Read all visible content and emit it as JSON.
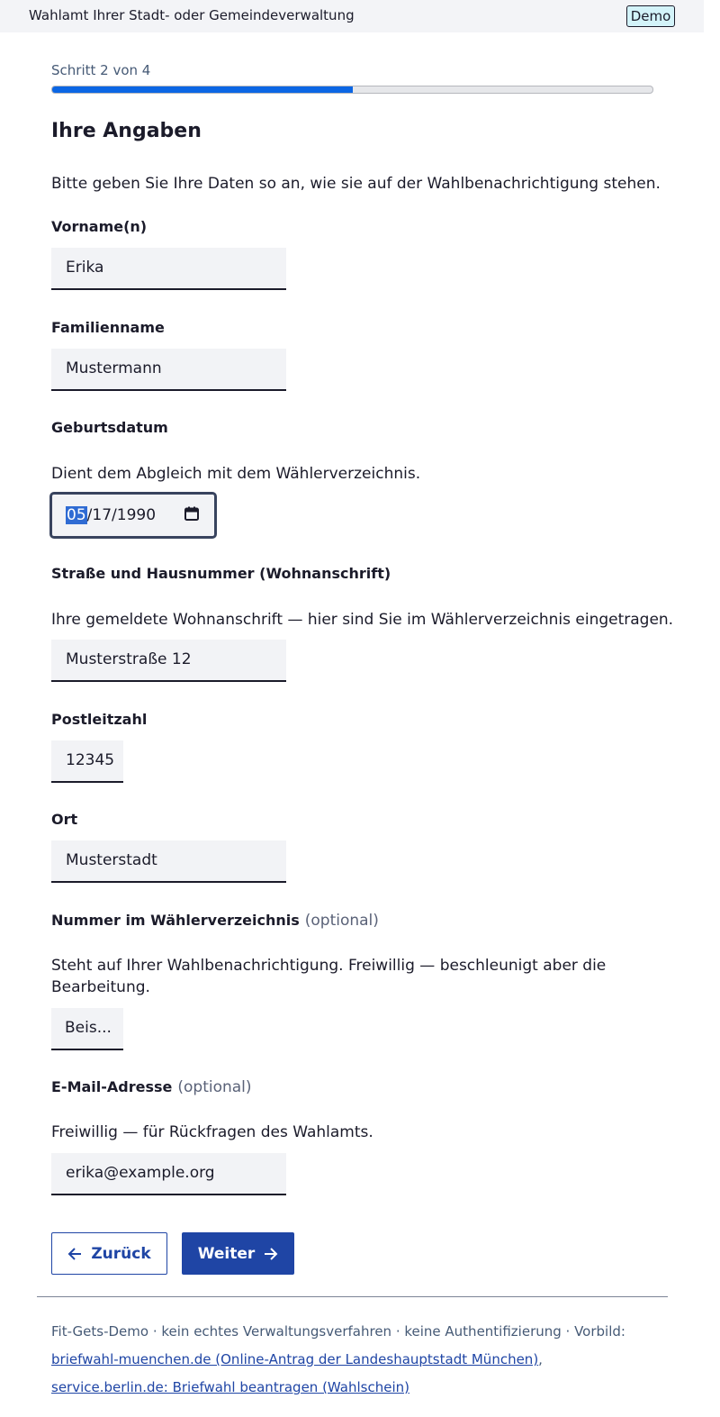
{
  "header": {
    "agency": "Wahlamt Ihrer Stadt- oder Gemeindeverwaltung",
    "badge": "Demo"
  },
  "progress": {
    "label": "Schritt 2 von 4",
    "fraction": 0.5
  },
  "form": {
    "title": "Ihre Angaben",
    "intro": "Bitte geben Sie Ihre Daten so an, wie sie auf der Wahlbenachrichtigung stehen.",
    "first_name": {
      "label": "Vorname(n)",
      "value": "Erika"
    },
    "last_name": {
      "label": "Familienname",
      "value": "Mustermann"
    },
    "birthdate": {
      "label": "Geburtsdatum",
      "hint": "Dient dem Abgleich mit dem Wählerverzeichnis.",
      "month": "05",
      "day": "17",
      "year": "1990",
      "sep": "/"
    },
    "street": {
      "label": "Straße und Hausnummer (Wohnanschrift)",
      "hint": "Ihre gemeldete Wohnanschrift — hier sind Sie im Wählerverzeichnis eingetragen.",
      "value": "Musterstraße 12"
    },
    "zip": {
      "label": "Postleitzahl",
      "value": "12345"
    },
    "city": {
      "label": "Ort",
      "value": "Musterstadt"
    },
    "register_number": {
      "label": "Nummer im Wählerverzeichnis",
      "optional": "(optional)",
      "hint": "Steht auf Ihrer Wahlbenachrichtigung. Freiwillig — beschleunigt aber die Bearbeitung.",
      "placeholder": "Beis..."
    },
    "email": {
      "label": "E-Mail-Adresse",
      "optional": "(optional)",
      "hint": "Freiwillig — für Rückfragen des Wahlamts.",
      "value": "erika@example.org"
    }
  },
  "buttons": {
    "back": "Zurück",
    "next": "Weiter"
  },
  "footer": {
    "text": "Fit-Gets-Demo · kein echtes Verwaltungsverfahren · keine Authentifizierung · Vorbild:",
    "link1": "briefwahl-muenchen.de (Online-Antrag der Landeshauptstadt München)",
    "sep": ",",
    "link2": "service.berlin.de: Briefwahl beantragen (Wahlschein)"
  },
  "colors": {
    "accent": "#1f45a5",
    "progress": "#0b66e4",
    "badge_bg": "#d3f3f9"
  },
  "icons": {
    "back": "arrow-left-icon",
    "next": "arrow-right-icon",
    "date": "calendar-icon"
  }
}
